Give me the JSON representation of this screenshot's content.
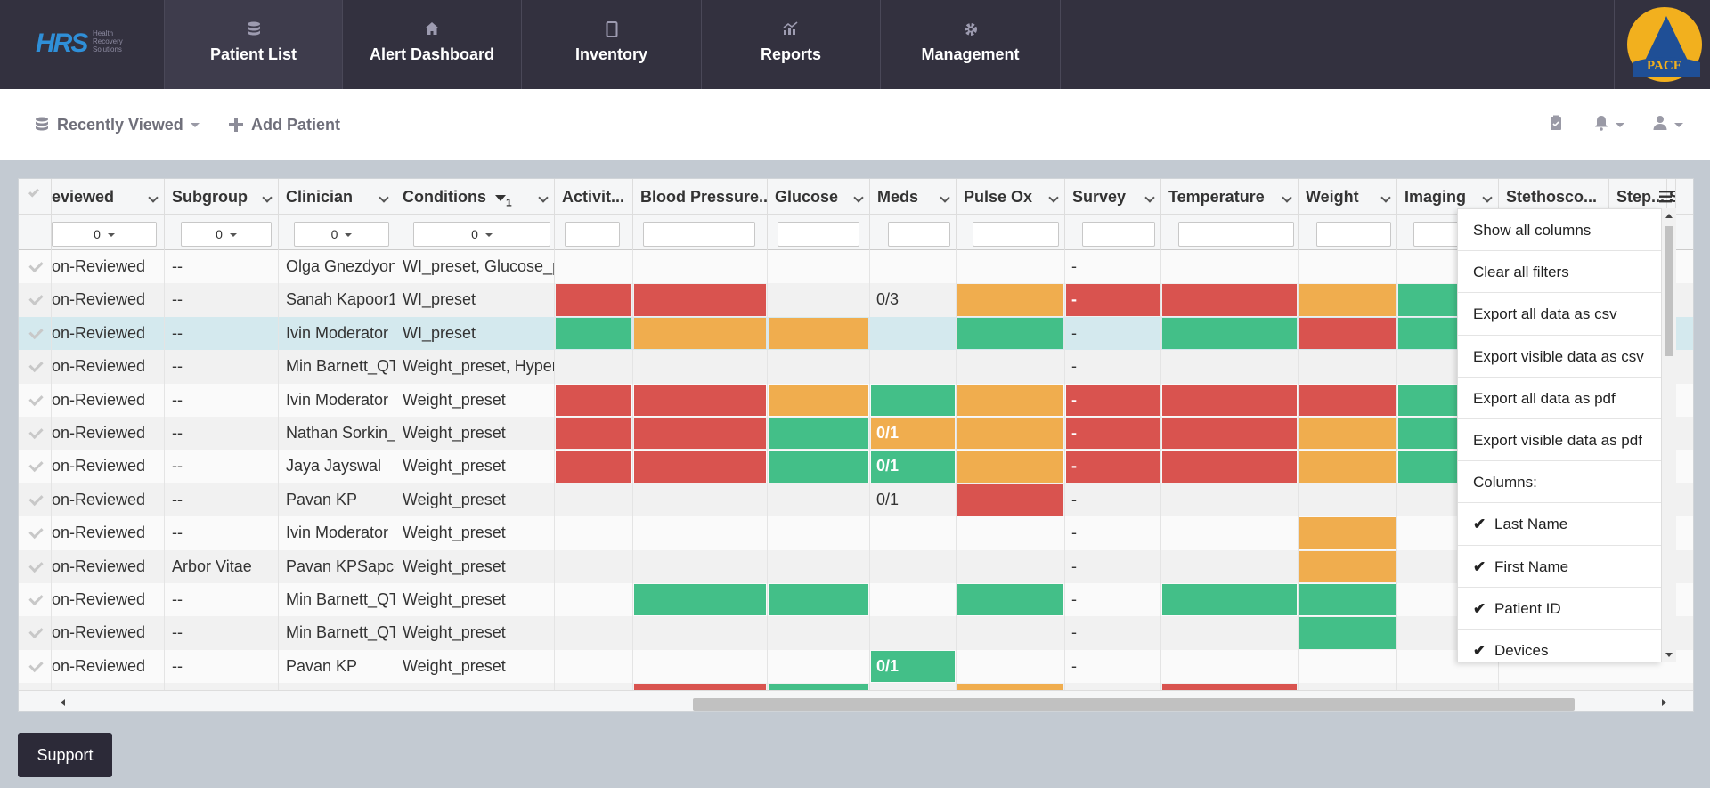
{
  "logo": {
    "brand": "HRS",
    "subtitle_lines": [
      "Health",
      "Recovery",
      "Solutions"
    ]
  },
  "nav": {
    "tabs": [
      {
        "label": "Patient List",
        "icon": "database-icon"
      },
      {
        "label": "Alert Dashboard",
        "icon": "home-icon"
      },
      {
        "label": "Inventory",
        "icon": "tablet-icon"
      },
      {
        "label": "Reports",
        "icon": "chart-icon"
      },
      {
        "label": "Management",
        "icon": "gear-icon"
      }
    ],
    "partner_logo_text": "PACE"
  },
  "subbar": {
    "recently_viewed": "Recently Viewed",
    "add_patient": "Add Patient"
  },
  "columns": [
    {
      "label": "eviewed"
    },
    {
      "label": "Subgroup"
    },
    {
      "label": "Clinician"
    },
    {
      "label": "Conditions",
      "sort_index": "1"
    },
    {
      "label": "Activit..."
    },
    {
      "label": "Blood Pressure..."
    },
    {
      "label": "Glucose"
    },
    {
      "label": "Meds"
    },
    {
      "label": "Pulse Ox"
    },
    {
      "label": "Survey"
    },
    {
      "label": "Temperature"
    },
    {
      "label": "Weight"
    },
    {
      "label": "Imaging"
    },
    {
      "label": "Stethosco..."
    },
    {
      "label": "Step..."
    },
    {
      "label": "S"
    }
  ],
  "filters": {
    "reviewed": "0",
    "subgroup": "0",
    "clinician": "0",
    "conditions": "0"
  },
  "status_colors": {
    "red": "#d9534f",
    "orange": "#f0ad4e",
    "green": "#43bf88"
  },
  "rows": [
    {
      "reviewed": "on-Reviewed",
      "subgroup": "--",
      "clinician": "Olga Gnezdyonc",
      "conditions": "WI_preset, Glucose_p",
      "activity": "",
      "bp": "",
      "glucose": "",
      "meds": "",
      "meds_text": "",
      "pulse": "",
      "survey": "",
      "survey_text": "-",
      "temp": "",
      "weight": "",
      "imaging": ""
    },
    {
      "reviewed": "on-Reviewed",
      "subgroup": "--",
      "clinician": "Sanah Kapoor1",
      "conditions": "WI_preset",
      "activity": "red",
      "bp": "red",
      "glucose": "",
      "meds": "",
      "meds_text": "0/3",
      "pulse": "orange",
      "survey": "red",
      "survey_text": "-",
      "temp": "red",
      "weight": "orange",
      "imaging": "green"
    },
    {
      "reviewed": "on-Reviewed",
      "subgroup": "--",
      "clinician": "Ivin Moderator",
      "conditions": "WI_preset",
      "activity": "green",
      "bp": "orange",
      "glucose": "orange",
      "meds": "",
      "meds_text": "",
      "pulse": "green",
      "survey": "",
      "survey_text": "-",
      "temp": "green",
      "weight": "red",
      "imaging": "green",
      "selected": true
    },
    {
      "reviewed": "on-Reviewed",
      "subgroup": "--",
      "clinician": "Min Barnett_QT",
      "conditions": "Weight_preset, Hyper",
      "activity": "",
      "bp": "",
      "glucose": "",
      "meds": "",
      "meds_text": "",
      "pulse": "",
      "survey": "",
      "survey_text": "-",
      "temp": "",
      "weight": "",
      "imaging": ""
    },
    {
      "reviewed": "on-Reviewed",
      "subgroup": "--",
      "clinician": "Ivin Moderator",
      "conditions": "Weight_preset",
      "activity": "red",
      "bp": "red",
      "glucose": "orange",
      "meds": "green",
      "meds_text": "",
      "pulse": "orange",
      "survey": "red",
      "survey_text": "-",
      "temp": "red",
      "weight": "red",
      "imaging": "green"
    },
    {
      "reviewed": "on-Reviewed",
      "subgroup": "--",
      "clinician": "Nathan Sorkin_C",
      "conditions": "Weight_preset",
      "activity": "red",
      "bp": "red",
      "glucose": "green",
      "meds": "orange",
      "meds_text": "0/1",
      "pulse": "orange",
      "survey": "red",
      "survey_text": "-",
      "temp": "red",
      "weight": "orange",
      "imaging": "green"
    },
    {
      "reviewed": "on-Reviewed",
      "subgroup": "--",
      "clinician": "Jaya Jayswal",
      "conditions": "Weight_preset",
      "activity": "red",
      "bp": "red",
      "glucose": "green",
      "meds": "green",
      "meds_text": "0/1",
      "pulse": "orange",
      "survey": "red",
      "survey_text": "-",
      "temp": "red",
      "weight": "orange",
      "imaging": "green"
    },
    {
      "reviewed": "on-Reviewed",
      "subgroup": "--",
      "clinician": "Pavan KP",
      "conditions": "Weight_preset",
      "activity": "",
      "bp": "",
      "glucose": "",
      "meds": "",
      "meds_text": "0/1",
      "pulse": "red",
      "survey": "",
      "survey_text": "-",
      "temp": "",
      "weight": "",
      "imaging": ""
    },
    {
      "reviewed": "on-Reviewed",
      "subgroup": "--",
      "clinician": "Ivin Moderator",
      "conditions": "Weight_preset",
      "activity": "",
      "bp": "",
      "glucose": "",
      "meds": "",
      "meds_text": "",
      "pulse": "",
      "survey": "",
      "survey_text": "-",
      "temp": "",
      "weight": "orange",
      "imaging": ""
    },
    {
      "reviewed": "on-Reviewed",
      "subgroup": "Arbor Vitae",
      "clinician": "Pavan KPSapces",
      "conditions": "Weight_preset",
      "activity": "",
      "bp": "",
      "glucose": "",
      "meds": "",
      "meds_text": "",
      "pulse": "",
      "survey": "",
      "survey_text": "-",
      "temp": "",
      "weight": "orange",
      "imaging": ""
    },
    {
      "reviewed": "on-Reviewed",
      "subgroup": "--",
      "clinician": "Min Barnett_QT",
      "conditions": "Weight_preset",
      "activity": "",
      "bp": "green",
      "glucose": "green",
      "meds": "",
      "meds_text": "",
      "pulse": "green",
      "survey": "",
      "survey_text": "-",
      "temp": "green",
      "weight": "green",
      "imaging": ""
    },
    {
      "reviewed": "on-Reviewed",
      "subgroup": "--",
      "clinician": "Min Barnett_QT",
      "conditions": "Weight_preset",
      "activity": "",
      "bp": "",
      "glucose": "",
      "meds": "",
      "meds_text": "",
      "pulse": "",
      "survey": "",
      "survey_text": "-",
      "temp": "",
      "weight": "green",
      "imaging": ""
    },
    {
      "reviewed": "on-Reviewed",
      "subgroup": "--",
      "clinician": "Pavan KP",
      "conditions": "Weight_preset",
      "activity": "",
      "bp": "",
      "glucose": "",
      "meds": "green",
      "meds_text": "0/1",
      "pulse": "",
      "survey": "",
      "survey_text": "-",
      "temp": "",
      "weight": "",
      "imaging": ""
    },
    {
      "reviewed": "",
      "subgroup": "",
      "clinician": "",
      "conditions": "",
      "activity": "",
      "bp": "red",
      "glucose": "green",
      "meds": "",
      "meds_text": "",
      "pulse": "orange",
      "survey": "",
      "survey_text": "",
      "temp": "red",
      "weight": "",
      "imaging": ""
    }
  ],
  "column_menu": {
    "actions": [
      "Show all columns",
      "Clear all filters",
      "Export all data as csv",
      "Export visible data as csv",
      "Export all data as pdf",
      "Export visible data as pdf"
    ],
    "columns_heading": "Columns:",
    "columns": [
      {
        "label": "Last Name",
        "checked": true
      },
      {
        "label": "First Name",
        "checked": true
      },
      {
        "label": "Patient ID",
        "checked": true
      },
      {
        "label": "Devices",
        "checked": true
      }
    ]
  },
  "support": {
    "label": "Support"
  }
}
